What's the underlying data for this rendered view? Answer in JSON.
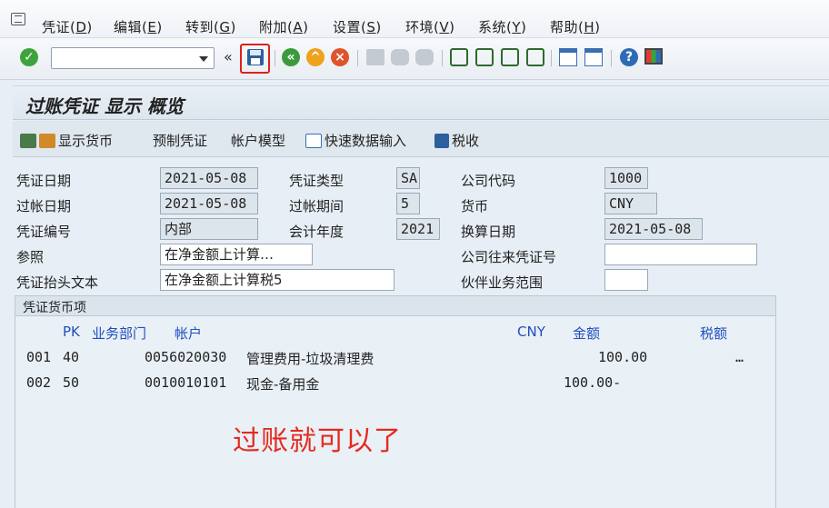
{
  "menu": {
    "items": [
      {
        "label": "凭证(",
        "key": "D",
        "close": ")"
      },
      {
        "label": "编辑(",
        "key": "E",
        "close": ")"
      },
      {
        "label": "转到(",
        "key": "G",
        "close": ")"
      },
      {
        "label": "附加(",
        "key": "A",
        "close": ")"
      },
      {
        "label": "设置(",
        "key": "S",
        "close": ")"
      },
      {
        "label": "环境(",
        "key": "V",
        "close": ")"
      },
      {
        "label": "系统(",
        "key": "Y",
        "close": ")"
      },
      {
        "label": "帮助(",
        "key": "H",
        "close": ")"
      }
    ]
  },
  "toolbar": {
    "command_value": "",
    "history_glyph": "«"
  },
  "title": "过账凭证 显示 概览",
  "app_toolbar": {
    "show_currency": "显示货币",
    "park_document": "预制凭证",
    "account_model": "帐户模型",
    "fast_entry": "快速数据输入",
    "tax": "税收"
  },
  "header": {
    "doc_date_label": "凭证日期",
    "doc_date": "2021-05-08",
    "doc_type_label": "凭证类型",
    "doc_type": "SA",
    "company_code_label": "公司代码",
    "company_code": "1000",
    "posting_date_label": "过帐日期",
    "posting_date": "2021-05-08",
    "period_label": "过帐期间",
    "period": "5",
    "currency_label": "货币",
    "currency": "CNY",
    "doc_number_label": "凭证编号",
    "doc_number": "内部",
    "fiscal_year_label": "会计年度",
    "fiscal_year": "2021",
    "translation_date_label": "换算日期",
    "translation_date": "2021-05-08",
    "reference_label": "参照",
    "reference": "在净金额上计算…",
    "cross_cc_label": "公司往来凭证号",
    "cross_cc": "",
    "header_text_label": "凭证抬头文本",
    "header_text": "在净金额上计算税5",
    "trading_partner_label": "伙伴业务范围",
    "trading_partner": ""
  },
  "items_panel": {
    "title": "凭证货币项",
    "columns": {
      "pk": "PK",
      "business_area": "业务部门",
      "account": "帐户",
      "currency": "CNY",
      "amount": "金额",
      "tax": "税额"
    },
    "rows": [
      {
        "line": "001",
        "pk": "40",
        "account": "0056020030",
        "text": "管理费用-垃圾清理费",
        "amount": "100.00",
        "tax": "…"
      },
      {
        "line": "002",
        "pk": "50",
        "account": "0010010101",
        "text": "现金-备用金",
        "amount": "100.00-",
        "tax": ""
      }
    ]
  },
  "annotation": "过账就可以了",
  "colors": {
    "accent_red": "#e52a1f",
    "column_header_blue": "#1f4fbf",
    "background": "#e7eef5"
  }
}
